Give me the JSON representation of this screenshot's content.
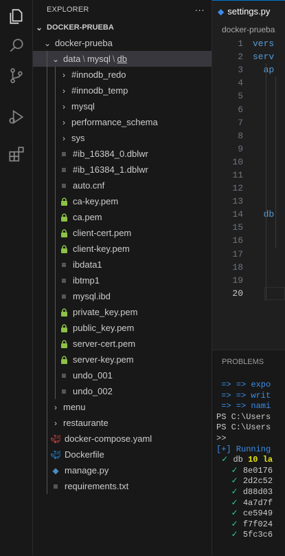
{
  "activity_bar": {
    "items": [
      {
        "icon": "files-icon"
      },
      {
        "icon": "search-icon"
      },
      {
        "icon": "source-control-icon"
      },
      {
        "icon": "run-debug-icon"
      },
      {
        "icon": "extensions-icon"
      }
    ]
  },
  "explorer": {
    "title": "EXPLORER",
    "more": "···",
    "root": "DOCKER-PRUEBA",
    "tree": [
      {
        "label": "docker-prueba",
        "type": "folder-open",
        "depth": 1
      },
      {
        "segments": [
          "data",
          "mysql",
          "db"
        ],
        "sep": "\\",
        "type": "folder-open",
        "depth": 2,
        "selected": true
      },
      {
        "label": "#innodb_redo",
        "type": "folder",
        "depth": 3
      },
      {
        "label": "#innodb_temp",
        "type": "folder",
        "depth": 3
      },
      {
        "label": "mysql",
        "type": "folder",
        "depth": 3
      },
      {
        "label": "performance_schema",
        "type": "folder",
        "depth": 3
      },
      {
        "label": "sys",
        "type": "folder",
        "depth": 3
      },
      {
        "label": "#ib_16384_0.dblwr",
        "type": "file-lines",
        "depth": 3
      },
      {
        "label": "#ib_16384_1.dblwr",
        "type": "file-lines",
        "depth": 3
      },
      {
        "label": "auto.cnf",
        "type": "file-lines",
        "depth": 3
      },
      {
        "label": "ca-key.pem",
        "type": "file-lock",
        "depth": 3
      },
      {
        "label": "ca.pem",
        "type": "file-lock",
        "depth": 3
      },
      {
        "label": "client-cert.pem",
        "type": "file-lock",
        "depth": 3
      },
      {
        "label": "client-key.pem",
        "type": "file-lock",
        "depth": 3
      },
      {
        "label": "ibdata1",
        "type": "file-lines",
        "depth": 3
      },
      {
        "label": "ibtmp1",
        "type": "file-lines",
        "depth": 3
      },
      {
        "label": "mysql.ibd",
        "type": "file-lines",
        "depth": 3
      },
      {
        "label": "private_key.pem",
        "type": "file-lock",
        "depth": 3
      },
      {
        "label": "public_key.pem",
        "type": "file-lock",
        "depth": 3
      },
      {
        "label": "server-cert.pem",
        "type": "file-lock",
        "depth": 3
      },
      {
        "label": "server-key.pem",
        "type": "file-lock",
        "depth": 3
      },
      {
        "label": "undo_001",
        "type": "file-lines",
        "depth": 3
      },
      {
        "label": "undo_002",
        "type": "file-lines",
        "depth": 3
      },
      {
        "label": "menu",
        "type": "folder",
        "depth": 2
      },
      {
        "label": "restaurante",
        "type": "folder",
        "depth": 2
      },
      {
        "label": "docker-compose.yaml",
        "type": "file-yaml",
        "depth": 2
      },
      {
        "label": "Dockerfile",
        "type": "file-docker",
        "depth": 2
      },
      {
        "label": "manage.py",
        "type": "file-python",
        "depth": 2
      },
      {
        "label": "requirements.txt",
        "type": "file-lines",
        "depth": 2
      }
    ]
  },
  "editor": {
    "tab_label": "settings.py",
    "breadcrumb": "docker-prueba",
    "current_line": 20,
    "lines": [
      {
        "n": "1",
        "text": "vers"
      },
      {
        "n": "2",
        "text": "serv"
      },
      {
        "n": "3",
        "text": "  ap"
      },
      {
        "n": "4",
        "text": ""
      },
      {
        "n": "5",
        "text": ""
      },
      {
        "n": "6",
        "text": ""
      },
      {
        "n": "7",
        "text": ""
      },
      {
        "n": "8",
        "text": ""
      },
      {
        "n": "9",
        "text": ""
      },
      {
        "n": "10",
        "text": ""
      },
      {
        "n": "11",
        "text": ""
      },
      {
        "n": "12",
        "text": ""
      },
      {
        "n": "13",
        "text": ""
      },
      {
        "n": "14",
        "text": "  db"
      },
      {
        "n": "15",
        "text": ""
      },
      {
        "n": "16",
        "text": ""
      },
      {
        "n": "17",
        "text": ""
      },
      {
        "n": "18",
        "text": ""
      },
      {
        "n": "19",
        "text": ""
      },
      {
        "n": "20",
        "text": ""
      }
    ]
  },
  "panel": {
    "tab": "PROBLEMS",
    "terminal": [
      {
        "parts": [
          {
            "t": " => => expo",
            "c": "blue"
          }
        ]
      },
      {
        "parts": [
          {
            "t": " => => writ",
            "c": "blue"
          }
        ]
      },
      {
        "parts": [
          {
            "t": " => => nami",
            "c": "blue"
          }
        ]
      },
      {
        "parts": [
          {
            "t": "PS C:\\Users",
            "c": "white"
          }
        ]
      },
      {
        "parts": [
          {
            "t": "PS C:\\Users",
            "c": "white"
          }
        ]
      },
      {
        "parts": [
          {
            "t": ">>",
            "c": "white"
          }
        ]
      },
      {
        "parts": [
          {
            "t": "[+] Running",
            "c": "blue"
          }
        ]
      },
      {
        "parts": [
          {
            "t": " ✓ ",
            "c": "green"
          },
          {
            "t": "db ",
            "c": "white"
          },
          {
            "t": "10 la",
            "c": "yellow"
          }
        ]
      },
      {
        "parts": [
          {
            "t": "   ✓ ",
            "c": "green"
          },
          {
            "t": "8e0176",
            "c": "white"
          }
        ]
      },
      {
        "parts": [
          {
            "t": "   ✓ ",
            "c": "green"
          },
          {
            "t": "2d2c52",
            "c": "white"
          }
        ]
      },
      {
        "parts": [
          {
            "t": "   ✓ ",
            "c": "green"
          },
          {
            "t": "d88d03",
            "c": "white"
          }
        ]
      },
      {
        "parts": [
          {
            "t": "   ✓ ",
            "c": "green"
          },
          {
            "t": "4a7d7f",
            "c": "white"
          }
        ]
      },
      {
        "parts": [
          {
            "t": "   ✓ ",
            "c": "green"
          },
          {
            "t": "ce5949",
            "c": "white"
          }
        ]
      },
      {
        "parts": [
          {
            "t": "   ✓ ",
            "c": "green"
          },
          {
            "t": "f7f024",
            "c": "white"
          }
        ]
      },
      {
        "parts": [
          {
            "t": "   ✓ ",
            "c": "green"
          },
          {
            "t": "5fc3c6",
            "c": "white"
          }
        ]
      }
    ]
  },
  "colors": {
    "accent": "#0078d4",
    "lock_icon": "#8dc149",
    "docker_icon": "#2496ed",
    "yaml_icon": "#e44d4d",
    "python_icon": "#4b8bbe"
  }
}
